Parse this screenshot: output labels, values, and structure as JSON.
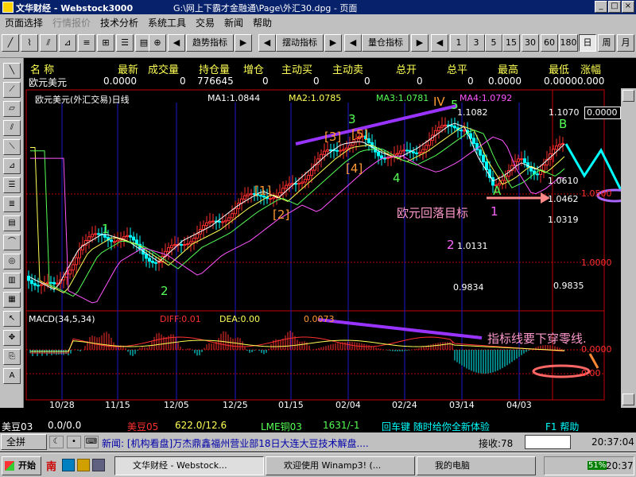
{
  "window": {
    "app_title": "文华财经 - Webstock3000",
    "doc_title": "G:\\网上下霸才金融通\\Page\\外汇30.dpg - 页面",
    "btn_min": "_",
    "btn_max": "□",
    "btn_close": "×"
  },
  "menu": {
    "items": [
      "页面选择",
      "行情报价",
      "技术分析",
      "系统工具",
      "交易",
      "新闻",
      "帮助"
    ]
  },
  "toolbar": {
    "trend_btn": "趋势指标",
    "swing_btn": "摆动指标",
    "volume_btn": "量仓指标",
    "periods": [
      "1",
      "3",
      "5",
      "15",
      "30",
      "60",
      "180",
      "日",
      "周",
      "月"
    ],
    "active_period": "日"
  },
  "quote": {
    "headers": [
      "名  称",
      "最新",
      "成交量",
      "持仓量",
      "增仓",
      "主动买",
      "主动卖",
      "总开",
      "总平",
      "最高",
      "最低",
      "涨幅"
    ],
    "row": [
      "欧元美元",
      "0.0000",
      "0",
      "776645",
      "0",
      "0",
      "0",
      "0",
      "0",
      "0.0000",
      "0.00000.000",
      ""
    ]
  },
  "chart": {
    "title": "欧元美元(外汇交易)日线",
    "ma1": "MA1:1.0844",
    "ma2": "MA2:1.0785",
    "ma3": "MA3:1.0781",
    "ma4": "MA4:1.0792",
    "price_box": "0.0000",
    "macd_title": "MACD(34,5,34)",
    "diff": "DIFF:0.01",
    "dea": "DEA:0.00",
    "macd_val": "0.0073",
    "dates": [
      "10/28",
      "11/15",
      "12/05",
      "12/25",
      "01/15",
      "02/04",
      "02/24",
      "03/14",
      "04/03"
    ],
    "price_labels": [
      "1.1082",
      "1.1070",
      "1.0610",
      "1.0462",
      "1.0319",
      "1.0131",
      "0.9834",
      "0.9835",
      "1.0500",
      "1.0000"
    ],
    "wave_labels": [
      "1",
      "2",
      "[1]",
      "[2]",
      "[3]",
      "[4]",
      "[5]",
      "3",
      "4",
      "IV",
      "5",
      "A",
      "B"
    ],
    "ann_target": "欧元回落目标",
    "ann_t1": "1",
    "ann_t2": "2",
    "ann_zero": "指标线要下穿零线.",
    "macd_scale_top": "0.0000",
    "macd_scale_bottom": "0.00"
  },
  "chart_data": {
    "type": "candlestick",
    "title": "欧元美元(外汇交易)日线",
    "categories": [
      "10/28",
      "11/15",
      "12/05",
      "12/25",
      "01/15",
      "02/04",
      "02/24",
      "03/14",
      "04/03"
    ],
    "series": [
      {
        "name": "MA1",
        "last": 1.0844
      },
      {
        "name": "MA2",
        "last": 1.0785
      },
      {
        "name": "MA3",
        "last": 1.0781
      },
      {
        "name": "MA4",
        "last": 1.0792
      }
    ],
    "price_marks": [
      1.1082,
      1.107,
      1.061,
      1.0462,
      1.0319,
      1.0131,
      0.9834,
      0.9835,
      1.05,
      1.0
    ],
    "ylim": [
      0.975,
      1.115
    ],
    "indicator": {
      "name": "MACD(34,5,34)",
      "DIFF": 0.01,
      "DEA": 0.0,
      "value": 0.0073
    }
  },
  "status": {
    "t1_name": "美豆03",
    "t1_val": "0.0/0.0",
    "t2_name": "美豆05",
    "t2_val": "622.0/12.6",
    "t3_name": "LME铜03",
    "t3_val": "1631/-1",
    "promo": "回车键 随时给你全新体验",
    "help": "F1 帮助"
  },
  "status2": {
    "btn_all": "全拼",
    "news": "新闻: [机构看盘]万杰鼎鑫福州营业部18日大连大豆技术解盘....",
    "recv": "接收:78",
    "time": "20:37:04"
  },
  "taskbar": {
    "start": "开始",
    "tasks": [
      "文华财经 - Webstock...",
      "欢迎使用 Winamp3! (...",
      "我的电脑"
    ],
    "clock": "20:37",
    "cpu": "51%"
  }
}
